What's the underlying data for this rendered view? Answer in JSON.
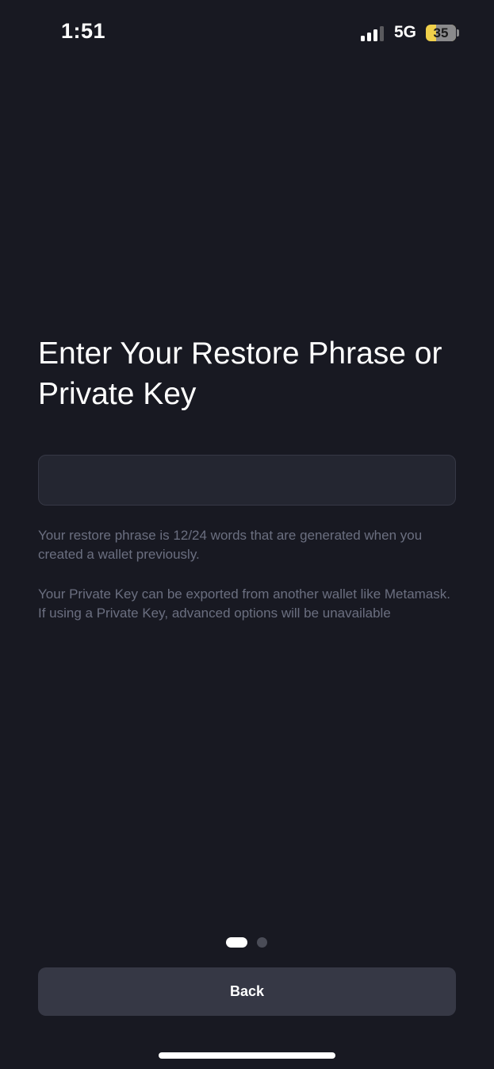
{
  "status_bar": {
    "time": "1:51",
    "network": "5G",
    "signal_bars_active": 3,
    "signal_bars_total": 4,
    "battery_level": "35",
    "battery_fraction": 0.35,
    "battery_color": "#f0d04b"
  },
  "title": "Enter Your Restore Phrase or Private Key",
  "input": {
    "value": "",
    "placeholder": ""
  },
  "helper_texts": [
    "Your restore phrase is 12/24 words that are generated when you created a wallet previously.",
    "Your Private Key can be exported from another wallet like Metamask. If using a Private Key, advanced options will be unavailable"
  ],
  "pagination": {
    "current_page": 1,
    "total_pages": 2
  },
  "back_button_label": "Back",
  "colors": {
    "background": "#181922",
    "input_background": "#242631",
    "button_background": "#363845",
    "helper_text": "#6b6f80"
  }
}
